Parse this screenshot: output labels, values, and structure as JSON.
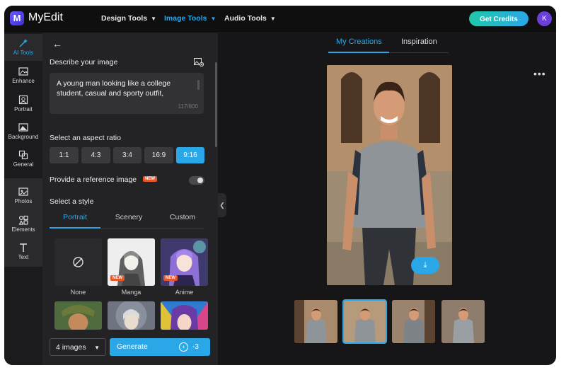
{
  "app": {
    "logo_letter": "M",
    "brand": "MyEdit"
  },
  "topnav": {
    "items": [
      {
        "label": "Design Tools",
        "active": false
      },
      {
        "label": "Image Tools",
        "active": true
      },
      {
        "label": "Audio Tools",
        "active": false
      }
    ],
    "credits_label": "Get Credits",
    "avatar_initial": "K"
  },
  "sidebar": {
    "items": [
      {
        "label": "AI Tools",
        "icon": "magic-wand-icon",
        "active": true
      },
      {
        "label": "Enhance",
        "icon": "image-enhance-icon"
      },
      {
        "label": "Portrait",
        "icon": "portrait-icon"
      },
      {
        "label": "Background",
        "icon": "background-icon"
      },
      {
        "label": "General",
        "icon": "general-icon"
      },
      {
        "label": "Photos",
        "icon": "photos-icon"
      },
      {
        "label": "Elements",
        "icon": "elements-icon"
      },
      {
        "label": "Text",
        "icon": "text-icon"
      }
    ]
  },
  "panel": {
    "describe_label": "Describe your image",
    "prompt": "A young man looking like a college student, casual and sporty outfit,",
    "char_count": "117/800",
    "aspect_label": "Select an aspect ratio",
    "ratios": [
      "1:1",
      "4:3",
      "3:4",
      "16:9",
      "9:16"
    ],
    "active_ratio": "9:16",
    "reference_label": "Provide a reference image",
    "new_badge": "NEW",
    "reference_enabled": false,
    "style_label": "Select a style",
    "style_tabs": [
      "Portrait",
      "Scenery",
      "Custom"
    ],
    "active_style_tab": "Portrait",
    "styles": [
      {
        "label": "None",
        "icon": "none-icon"
      },
      {
        "label": "Manga",
        "badge": "NEW"
      },
      {
        "label": "Anime",
        "badge": "NEW"
      }
    ],
    "count_select": "4 images",
    "generate_label": "Generate",
    "generate_cost": "-3"
  },
  "main": {
    "tabs": [
      "My Creations",
      "Inspiration"
    ],
    "active_tab": "My Creations",
    "more_label": "•••"
  },
  "colors": {
    "accent": "#2aa7e6",
    "badge": "#e8562a",
    "panel_bg": "#232325",
    "app_bg": "#161618"
  }
}
